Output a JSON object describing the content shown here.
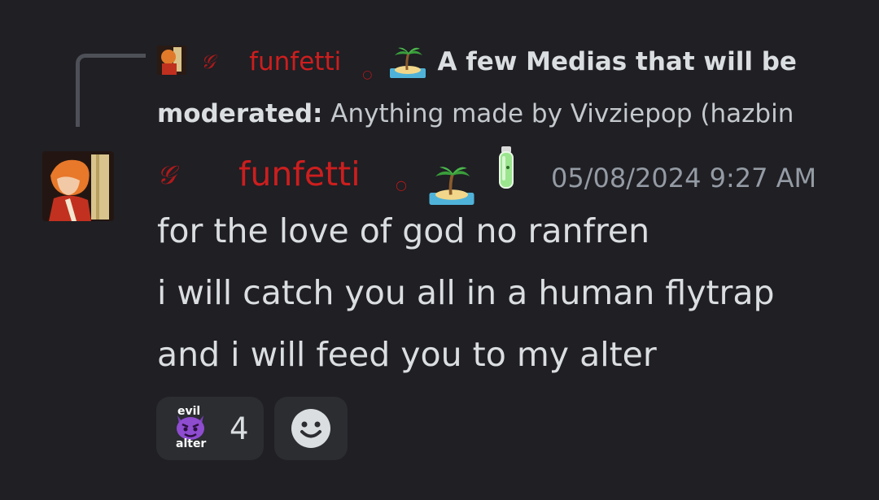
{
  "reply": {
    "author": "funfetti",
    "bold_text": "A few Medias that will be moderated:",
    "bold_line1": "A few Medias that will be",
    "bold_line2": "moderated:",
    "rest_text": " Anything made by Vivziepop (hazbin"
  },
  "message": {
    "author": "funfetti",
    "timestamp": "05/08/2024 9:27 AM",
    "lines": [
      "for the love of god no ranfren",
      "i will catch you all in a human flytrap",
      "and i will feed you to my alter"
    ]
  },
  "reactions": [
    {
      "emoji": "evil-alter-emoji",
      "emoji_top": "evil",
      "emoji_bottom": "alter",
      "count": "4"
    },
    {
      "emoji": "add-reaction-icon"
    }
  ],
  "colors": {
    "background": "#1f1f24",
    "username": "#cc1e1e",
    "text": "#dbdee1",
    "timestamp": "#949ba4",
    "reaction_bg": "#2b2d31"
  },
  "icons": {
    "role_icon": "g-icon",
    "separator": "dot-icon",
    "badge_1": "island-icon",
    "badge_2": "potion-icon"
  }
}
